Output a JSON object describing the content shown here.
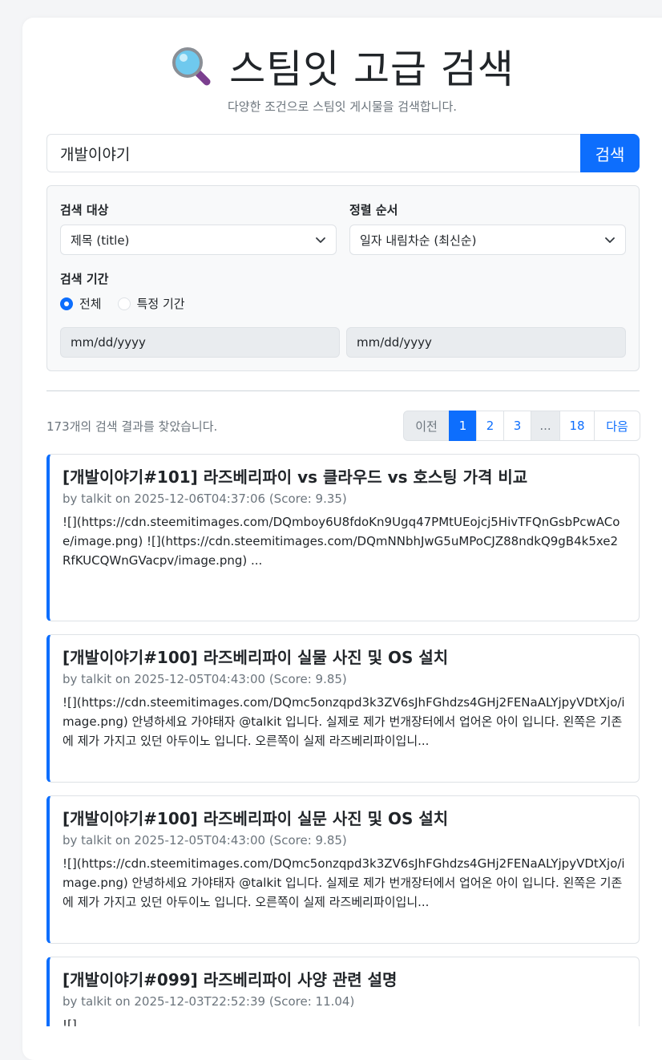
{
  "header": {
    "title": "스팀잇 고급 검색",
    "subtitle": "다양한 조건으로 스팀잇 게시물을 검색합니다."
  },
  "search": {
    "value": "개발이야기",
    "button_label": "검색"
  },
  "filters": {
    "target_label": "검색 대상",
    "target_value": "제목 (title)",
    "sort_label": "정렬 순서",
    "sort_value": "일자 내림차순 (최신순)",
    "period_label": "검색 기간",
    "period_all": "전체",
    "period_custom": "특정 기간",
    "date_start_placeholder": "mm/dd/yyyy",
    "date_end_placeholder": "mm/dd/yyyy"
  },
  "results": {
    "count_text": "173개의 검색 결과를 찾았습니다.",
    "pagination": {
      "prev": "이전",
      "p1": "1",
      "p2": "2",
      "p3": "3",
      "ellipsis": "...",
      "last": "18",
      "next": "다음"
    },
    "items": [
      {
        "title": "[개발이야기#101] 라즈베리파이 vs 클라우드 vs 호스팅 가격 비교",
        "meta": "by talkit on 2025-12-06T04:37:06 (Score: 9.35)",
        "body": "![](https://cdn.steemitimages.com/DQmboy6U8fdoKn9Ugq47PMtUEojcj5HivTFQnGsbPcwACoe/image.png) ![](https://cdn.steemitimages.com/DQmNNbhJwG5uMPoCJZ88ndkQ9gB4k5xe2RfKUCQWnGVacpv/image.png) ..."
      },
      {
        "title": "[개발이야기#100] 라즈베리파이 실물 사진 및 OS 설치",
        "meta": "by talkit on 2025-12-05T04:43:00 (Score: 9.85)",
        "body": "![](https://cdn.steemitimages.com/DQmc5onzqpd3k3ZV6sJhFGhdzs4GHj2FENaALYjpyVDtXjo/image.png) 안녕하세요 가야태자 @talkit 입니다. 실제로 제가 번개장터에서 업어온 아이 입니다. 왼쪽은 기존에 제가 가지고 있던 아두이노 입니다. 오른쪽이 실제 라즈베리파이입니..."
      },
      {
        "title": "[개발이야기#100] 라즈베리파이 실문 사진 및 OS 설치",
        "meta": "by talkit on 2025-12-05T04:43:00 (Score: 9.85)",
        "body": "![](https://cdn.steemitimages.com/DQmc5onzqpd3k3ZV6sJhFGhdzs4GHj2FENaALYjpyVDtXjo/image.png) 안녕하세요 가야태자 @talkit 입니다. 실제로 제가 번개장터에서 업어온 아이 입니다. 왼쪽은 기존에 제가 가지고 있던 아두이노 입니다. 오른쪽이 실제 라즈베리파이입니..."
      },
      {
        "title": "[개발이야기#099] 라즈베리파이 사양 관련 설명",
        "meta": "by talkit on 2025-12-03T22:52:39 (Score: 11.04)",
        "body": "![]"
      }
    ]
  }
}
